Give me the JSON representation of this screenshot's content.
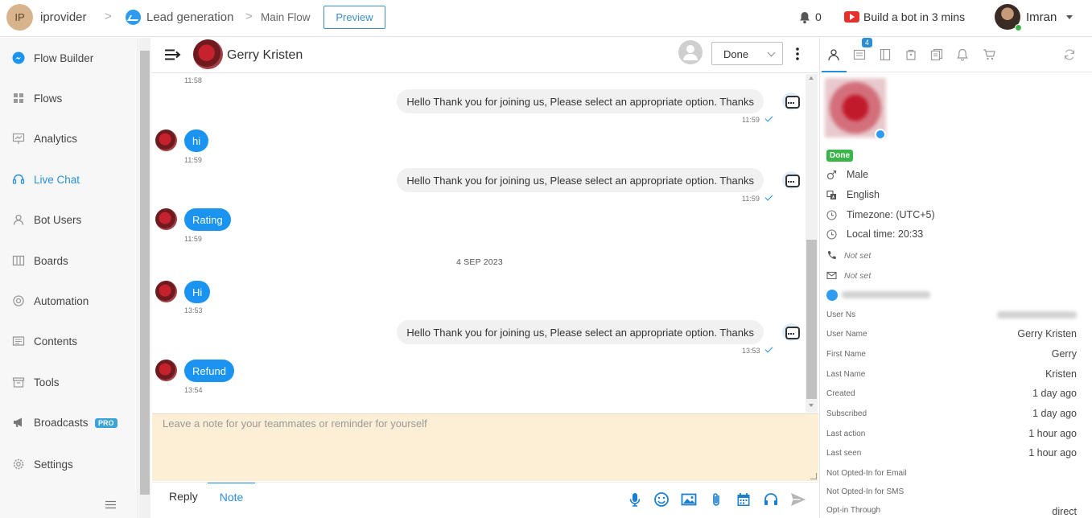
{
  "header": {
    "workspace_initials": "IP",
    "workspace_name": "iprovider",
    "breadcrumb_sep": ">",
    "breadcrumb_bot": "Lead generation",
    "breadcrumb_flow": "Main Flow",
    "preview_label": "Preview",
    "notification_count": "0",
    "build_bot_label": "Build a bot in 3 mins",
    "user_name": "Imran"
  },
  "sidebar": {
    "items": [
      {
        "label": "Flow Builder",
        "icon": "messenger-icon"
      },
      {
        "label": "Flows",
        "icon": "grid-icon"
      },
      {
        "label": "Analytics",
        "icon": "chart-icon"
      },
      {
        "label": "Live Chat",
        "icon": "headset-icon",
        "active": true
      },
      {
        "label": "Bot Users",
        "icon": "user-icon"
      },
      {
        "label": "Boards",
        "icon": "board-icon"
      },
      {
        "label": "Automation",
        "icon": "automation-icon"
      },
      {
        "label": "Contents",
        "icon": "contents-icon"
      },
      {
        "label": "Tools",
        "icon": "tools-icon"
      },
      {
        "label": "Broadcasts",
        "icon": "megaphone-icon",
        "badge": "PRO"
      },
      {
        "label": "Settings",
        "icon": "gear-icon"
      }
    ]
  },
  "chat": {
    "contact_name": "Gerry Kristen",
    "status_value": "Done",
    "first_time": "11:58",
    "messages": [
      {
        "from": "bot",
        "text": "Hello Thank you for joining us, Please select an appropriate option. Thanks",
        "time": "11:59"
      },
      {
        "from": "user",
        "text": "hi",
        "time": "11:59"
      },
      {
        "from": "bot",
        "text": "Hello Thank you for joining us, Please select an appropriate option. Thanks",
        "time": "11:59"
      },
      {
        "from": "user",
        "text": "Rating",
        "time": "11:59"
      },
      {
        "from": "bot",
        "text": "Hello Thank you for joining us, Please select an appropriate option. Thanks",
        "time": "13:53"
      },
      {
        "from": "user",
        "text": "Hi",
        "time": "13:53"
      },
      {
        "from": "user",
        "text": "Refund",
        "time": "13:54"
      }
    ],
    "date_separator": "4 SEP 2023"
  },
  "composer": {
    "note_placeholder": "Leave a note for your teammates or reminder for yourself",
    "tab_reply": "Reply",
    "tab_note": "Note"
  },
  "profile": {
    "tab_badge": "4",
    "status_badge": "Done",
    "gender": "Male",
    "language": "English",
    "timezone": "Timezone: (UTC+5)",
    "local_time": "Local time: 20:33",
    "phone": "Not set",
    "email": "Not set",
    "attributes": [
      {
        "key": "User Ns",
        "value": ""
      },
      {
        "key": "User Name",
        "value": "Gerry Kristen"
      },
      {
        "key": "First Name",
        "value": "Gerry"
      },
      {
        "key": "Last Name",
        "value": "Kristen"
      },
      {
        "key": "Created",
        "value": "1 day ago"
      },
      {
        "key": "Subscribed",
        "value": "1 day ago"
      },
      {
        "key": "Last action",
        "value": "1 hour ago"
      },
      {
        "key": "Last seen",
        "value": "1 hour ago"
      },
      {
        "key": "Not Opted-In for Email",
        "value": ""
      },
      {
        "key": "Not Opted-In for SMS",
        "value": ""
      },
      {
        "key": "Opt-in Through",
        "value": "direct"
      }
    ]
  }
}
